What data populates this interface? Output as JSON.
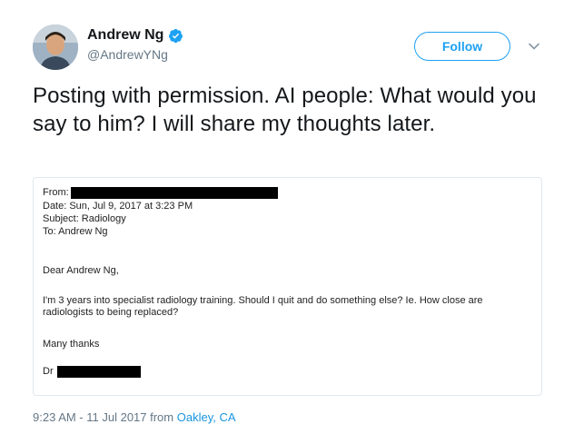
{
  "author": {
    "display_name": "Andrew Ng",
    "handle": "@AndrewYNg",
    "verified": true
  },
  "actions": {
    "follow_label": "Follow",
    "more_icon": "chevron-down-icon"
  },
  "tweet": {
    "text": "Posting with permission. AI people: What would you say to him? I will share my thoughts later."
  },
  "email": {
    "from_label": "From:",
    "date_line": "Date: Sun, Jul 9, 2017 at 3:23 PM",
    "subject_line": "Subject: Radiology",
    "to_line": "To: Andrew Ng",
    "greeting": "Dear Andrew Ng,",
    "body": "I'm 3 years into specialist radiology training. Should I quit and do something else? Ie. How close are radiologists to being replaced?",
    "closing": "Many thanks",
    "signature_prefix": "Dr"
  },
  "meta": {
    "timestamp": "9:23 AM - 11 Jul 2017 from ",
    "location": "Oakley, CA"
  },
  "colors": {
    "accent": "#1da1f2",
    "secondary_text": "#657786",
    "redaction": "#000000"
  }
}
